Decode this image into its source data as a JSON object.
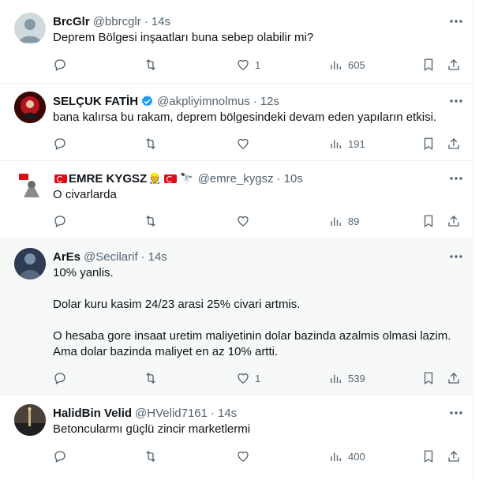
{
  "tweets": [
    {
      "name": "BrcGlr",
      "handle": "@bbrcglr",
      "dot": "·",
      "time": "14s",
      "text": [
        "Deprem Bölgesi inşaatları buna sebep olabilir mi?"
      ],
      "replies": "",
      "reposts": "",
      "likes": "1",
      "views": "605"
    },
    {
      "name": "SELÇUK FATİH",
      "handle": "@akpliyimnolmus",
      "dot": "·",
      "time": "12s",
      "text": [
        "bana kalırsa bu rakam, deprem bölgesindeki devam eden yapıların etkisi."
      ],
      "replies": "",
      "reposts": "",
      "likes": "",
      "views": "191"
    },
    {
      "name": "EMRE KYGSZ",
      "handle": "@emre_kygsz",
      "dot": "·",
      "time": "10s",
      "text": [
        "O civarlarda"
      ],
      "replies": "",
      "reposts": "",
      "likes": "",
      "views": "89"
    },
    {
      "name": "ArEs",
      "handle": "@Secilarif",
      "dot": "·",
      "time": "14s",
      "text": [
        "10% yanlis.",
        "",
        "Dolar kuru kasim 24/23 arasi 25% civari artmis.",
        "",
        "O hesaba gore insaat uretim maliyetinin dolar bazinda azalmis olmasi lazim.",
        "Ama dolar bazinda maliyet en az 10% artti."
      ],
      "replies": "",
      "reposts": "",
      "likes": "1",
      "views": "539"
    },
    {
      "name": "HalidBin Velid",
      "handle": "@HVelid7161",
      "dot": "·",
      "time": "14s",
      "text": [
        "Betoncularmı güçlü zincir marketlermi"
      ],
      "replies": "",
      "reposts": "",
      "likes": "",
      "views": "400"
    }
  ],
  "icons": {
    "more": "more-horizontal-icon",
    "reply": "reply-icon",
    "repost": "repost-icon",
    "like": "heart-icon",
    "views": "views-chart-icon",
    "bookmark": "bookmark-icon",
    "share": "share-icon",
    "verified": "verified-badge-icon"
  },
  "colors": {
    "text": "#0f1419",
    "muted": "#536471",
    "border": "#eff3f4",
    "highlight": "#f7f9f9",
    "verified": "#1d9bf0"
  }
}
